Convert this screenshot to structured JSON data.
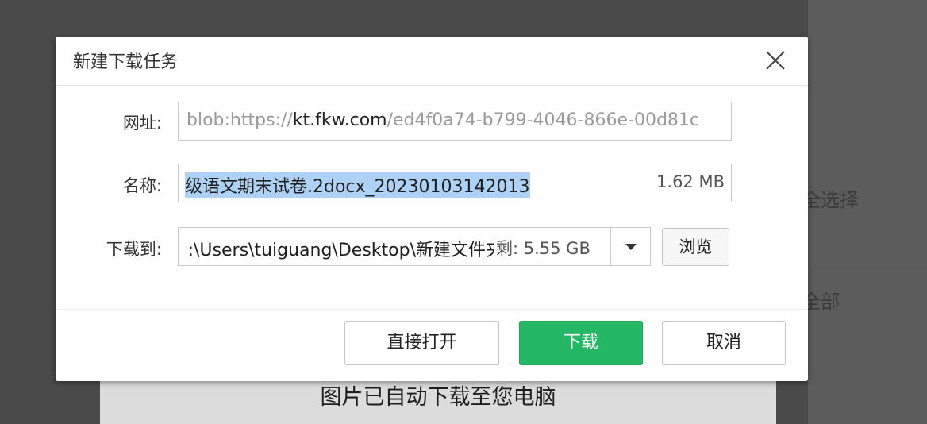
{
  "background": {
    "select_text": "全选择",
    "all_text": "全部",
    "caption": "图片已自动下载至您电脑"
  },
  "dialog": {
    "title": "新建下载任务",
    "url": {
      "label": "网址:",
      "prefix": "blob:https://",
      "host": "kt.fkw.com",
      "suffix": "/ed4f0a74-b799-4046-866e-00d81c"
    },
    "name": {
      "label": "名称:",
      "value": "级语文期末试卷.2docx_20230103142013",
      "size": "1.62 MB"
    },
    "save_to": {
      "label": "下载到:",
      "path": "C:\\Users\\tuiguang\\Desktop\\新建文件夹",
      "free_space": "剩: 5.55 GB",
      "browse_label": "浏览"
    },
    "buttons": {
      "open_directly": "直接打开",
      "download": "下载",
      "cancel": "取消"
    }
  },
  "colors": {
    "download_button": "#25b864",
    "selection_highlight": "#aed2f5",
    "overlay": "#4a4a4a"
  },
  "icons": {
    "close": "close-icon",
    "dropdown": "caret-down-icon"
  }
}
